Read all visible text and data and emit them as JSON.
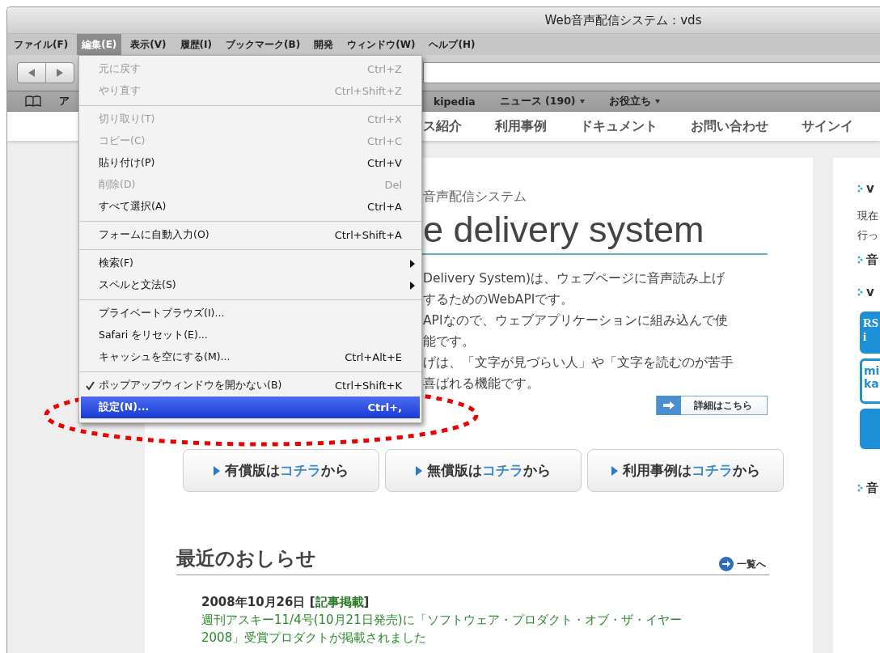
{
  "window": {
    "title": "Web音声配信システム：vds"
  },
  "menubar": [
    {
      "label": "ファイル(F)",
      "selected": false
    },
    {
      "label": "編集(E)",
      "selected": true
    },
    {
      "label": "表示(V)",
      "selected": false
    },
    {
      "label": "履歴(I)",
      "selected": false
    },
    {
      "label": "ブックマーク(B)",
      "selected": false
    },
    {
      "label": "開発",
      "selected": false
    },
    {
      "label": "ウィンドウ(W)",
      "selected": false
    },
    {
      "label": "ヘルプ(H)",
      "selected": false
    }
  ],
  "edit_menu": {
    "items": [
      {
        "kind": "item",
        "label": "元に戻す",
        "shortcut": "Ctrl+Z",
        "disabled": true,
        "checked": false,
        "submenu": false,
        "selected": false
      },
      {
        "kind": "item",
        "label": "やり直す",
        "shortcut": "Ctrl+Shift+Z",
        "disabled": true,
        "checked": false,
        "submenu": false,
        "selected": false
      },
      {
        "kind": "separator"
      },
      {
        "kind": "item",
        "label": "切り取り(T)",
        "shortcut": "Ctrl+X",
        "disabled": true,
        "checked": false,
        "submenu": false,
        "selected": false
      },
      {
        "kind": "item",
        "label": "コピー(C)",
        "shortcut": "Ctrl+C",
        "disabled": true,
        "checked": false,
        "submenu": false,
        "selected": false
      },
      {
        "kind": "item",
        "label": "貼り付け(P)",
        "shortcut": "Ctrl+V",
        "disabled": false,
        "checked": false,
        "submenu": false,
        "selected": false
      },
      {
        "kind": "item",
        "label": "削除(D)",
        "shortcut": "Del",
        "disabled": true,
        "checked": false,
        "submenu": false,
        "selected": false
      },
      {
        "kind": "item",
        "label": "すべて選択(A)",
        "shortcut": "Ctrl+A",
        "disabled": false,
        "checked": false,
        "submenu": false,
        "selected": false
      },
      {
        "kind": "separator"
      },
      {
        "kind": "item",
        "label": "フォームに自動入力(O)",
        "shortcut": "Ctrl+Shift+A",
        "disabled": false,
        "checked": false,
        "submenu": false,
        "selected": false
      },
      {
        "kind": "separator"
      },
      {
        "kind": "item",
        "label": "検索(F)",
        "disabled": false,
        "checked": false,
        "submenu": true,
        "selected": false
      },
      {
        "kind": "item",
        "label": "スペルと文法(S)",
        "disabled": false,
        "checked": false,
        "submenu": true,
        "selected": false
      },
      {
        "kind": "separator"
      },
      {
        "kind": "item",
        "label": "プライベートブラウズ(I)...",
        "disabled": false,
        "checked": false,
        "submenu": false,
        "selected": false
      },
      {
        "kind": "item",
        "label": "Safari をリセット(E)...",
        "disabled": false,
        "checked": false,
        "submenu": false,
        "selected": false
      },
      {
        "kind": "item",
        "label": "キャッシュを空にする(M)...",
        "shortcut": "Ctrl+Alt+E",
        "disabled": false,
        "checked": false,
        "submenu": false,
        "selected": false
      },
      {
        "kind": "separator"
      },
      {
        "kind": "item",
        "label": "ポップアップウィンドウを開かない(B)",
        "shortcut": "Ctrl+Shift+K",
        "disabled": false,
        "checked": true,
        "submenu": false,
        "selected": false
      },
      {
        "kind": "item",
        "label": "設定(N)...",
        "shortcut": "Ctrl+,",
        "disabled": false,
        "checked": false,
        "submenu": false,
        "selected": true
      }
    ]
  },
  "bookmarks_bar": [
    {
      "label": "ア",
      "menu": false
    },
    {
      "label": "kipedia",
      "menu": false
    },
    {
      "label": "ニュース (190)",
      "menu": true
    },
    {
      "label": "お役立ち",
      "menu": true
    }
  ],
  "site_nav": [
    "ス紹介",
    "利用事例",
    "ドキュメント",
    "お問い合わせ",
    "サインイ"
  ],
  "hero": {
    "subtitle": "音声配信システム",
    "title": "e delivery system",
    "paragraph_lines": [
      "Delivery System)は、ウェブページに音声読み上げ",
      "するためのWebAPIです。",
      "APIなので、ウェブアプリケーションに組み込んで使",
      "能です。",
      "げは、「文字が見づらい人」や「文字を読むのが苦手",
      "喜ばれる機能です。"
    ],
    "details_button": "詳細はこちら"
  },
  "cta_buttons": [
    {
      "prefix": "有償版は",
      "link": "コチラ",
      "suffix": "から"
    },
    {
      "prefix": "無償版は",
      "link": "コチラ",
      "suffix": "から"
    },
    {
      "prefix": "利用事例は",
      "link": "コチラ",
      "suffix": "から"
    }
  ],
  "news": {
    "title": "最近のおしらせ",
    "more": "一覧へ",
    "items": [
      {
        "date": "2008年10月26日 [",
        "tag": "記事掲載",
        "tag_end": "]",
        "lines": [
          "週刊アスキー11/4号(10月21日発売)に「ソフトウェア・プロダクト・オブ・ザ・イヤー",
          "2008」受賞プロダクトが掲載されました"
        ]
      }
    ]
  },
  "sidebar": [
    {
      "kind": "heading",
      "text": "v"
    },
    {
      "kind": "text",
      "text": "現在"
    },
    {
      "kind": "text",
      "text": "行っ"
    },
    {
      "kind": "heading",
      "text": "音"
    },
    {
      "kind": "heading",
      "text": "v"
    },
    {
      "kind": "banner",
      "lines": [
        "RS",
        "i"
      ]
    },
    {
      "kind": "outline_banner",
      "lines": [
        "mi",
        "ka"
      ]
    },
    {
      "kind": "block"
    },
    {
      "kind": "heading",
      "text": "音"
    }
  ]
}
